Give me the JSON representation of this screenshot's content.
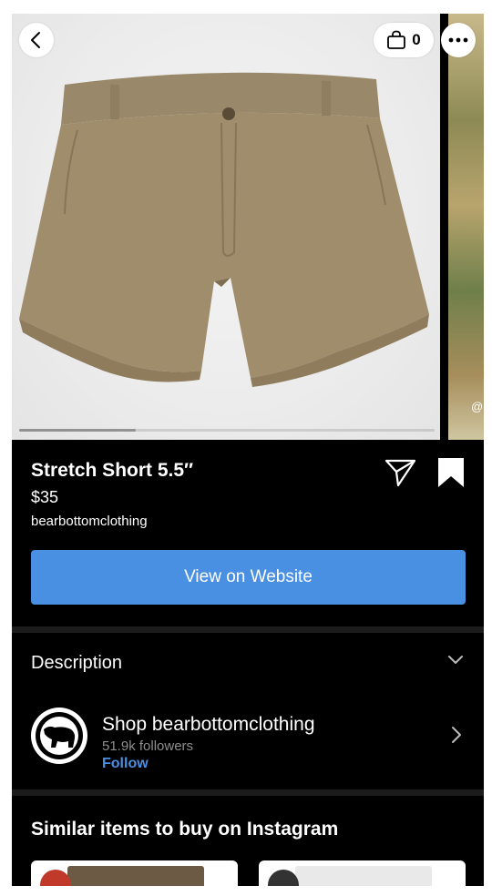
{
  "product": {
    "title": "Stretch Short 5.5″",
    "price": "$35",
    "seller": "bearbottomclothing",
    "image_progress": 0.28
  },
  "header": {
    "bag_count": "0"
  },
  "next_photo": {
    "tag": "@"
  },
  "actions": {
    "view_website_label": "View on Website"
  },
  "description": {
    "label": "Description"
  },
  "shop": {
    "name": "Shop bearbottomclothing",
    "followers": "51.9k followers",
    "follow_label": "Follow"
  },
  "similar": {
    "title": "Similar items to buy on Instagram"
  },
  "colors": {
    "background": "#000000",
    "accent": "#4a90e2",
    "product_khaki": "#a08d6c"
  },
  "icons": {
    "back": "back-chevron-icon",
    "bag": "shopping-bag-icon",
    "more": "more-dots-icon",
    "share": "paper-plane-icon",
    "bookmark": "bookmark-icon",
    "expand": "chevron-down-icon",
    "open": "chevron-right-icon",
    "shop_logo": "bear-logo-icon"
  }
}
